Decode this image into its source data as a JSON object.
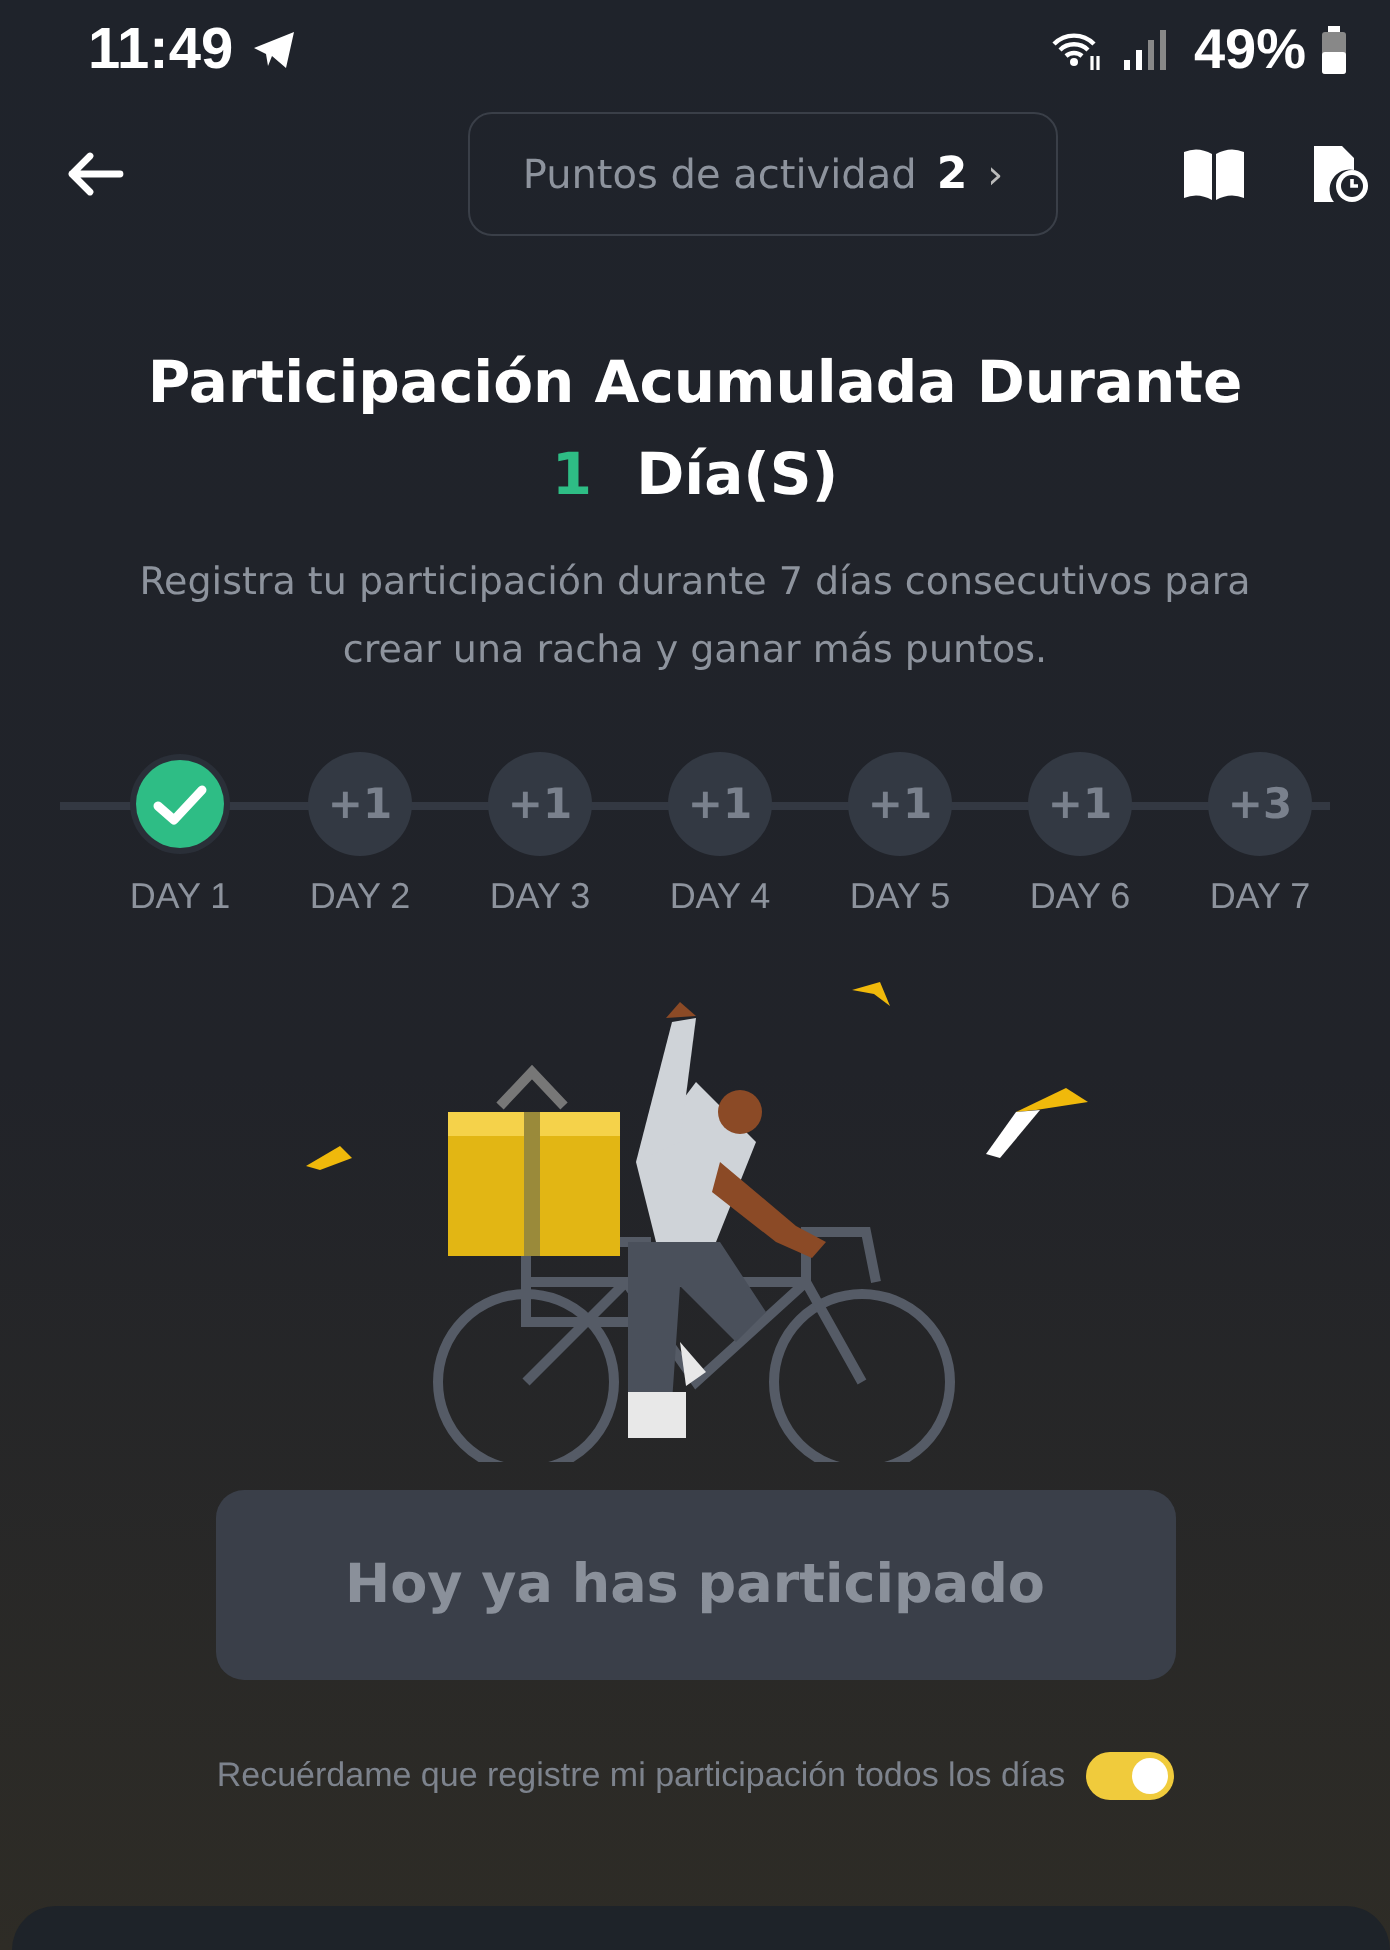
{
  "status_bar": {
    "time": "11:49",
    "battery": "49%"
  },
  "header": {
    "points_label": "Puntos de actividad",
    "points_value": "2",
    "points_arrow": "›"
  },
  "title": {
    "text": "Participación Acumulada Durante",
    "count": "1",
    "unit": "Día(S)"
  },
  "subtitle": "Registra tu participación durante 7 días consecutivos para crear una racha y ganar más puntos.",
  "days": [
    {
      "label": "DAY 1",
      "done": true
    },
    {
      "label": "DAY 2",
      "bonus": "+1",
      "done": false
    },
    {
      "label": "DAY 3",
      "bonus": "+1",
      "done": false
    },
    {
      "label": "DAY 4",
      "bonus": "+1",
      "done": false
    },
    {
      "label": "DAY 5",
      "bonus": "+1",
      "done": false
    },
    {
      "label": "DAY 6",
      "bonus": "+1",
      "done": false
    },
    {
      "label": "DAY 7",
      "bonus": "+3",
      "done": false
    }
  ],
  "action_button": {
    "label": "Hoy ya has participado",
    "disabled": true
  },
  "reminder": {
    "label": "Recuérdame que registre mi participación todos los días",
    "on": true
  }
}
